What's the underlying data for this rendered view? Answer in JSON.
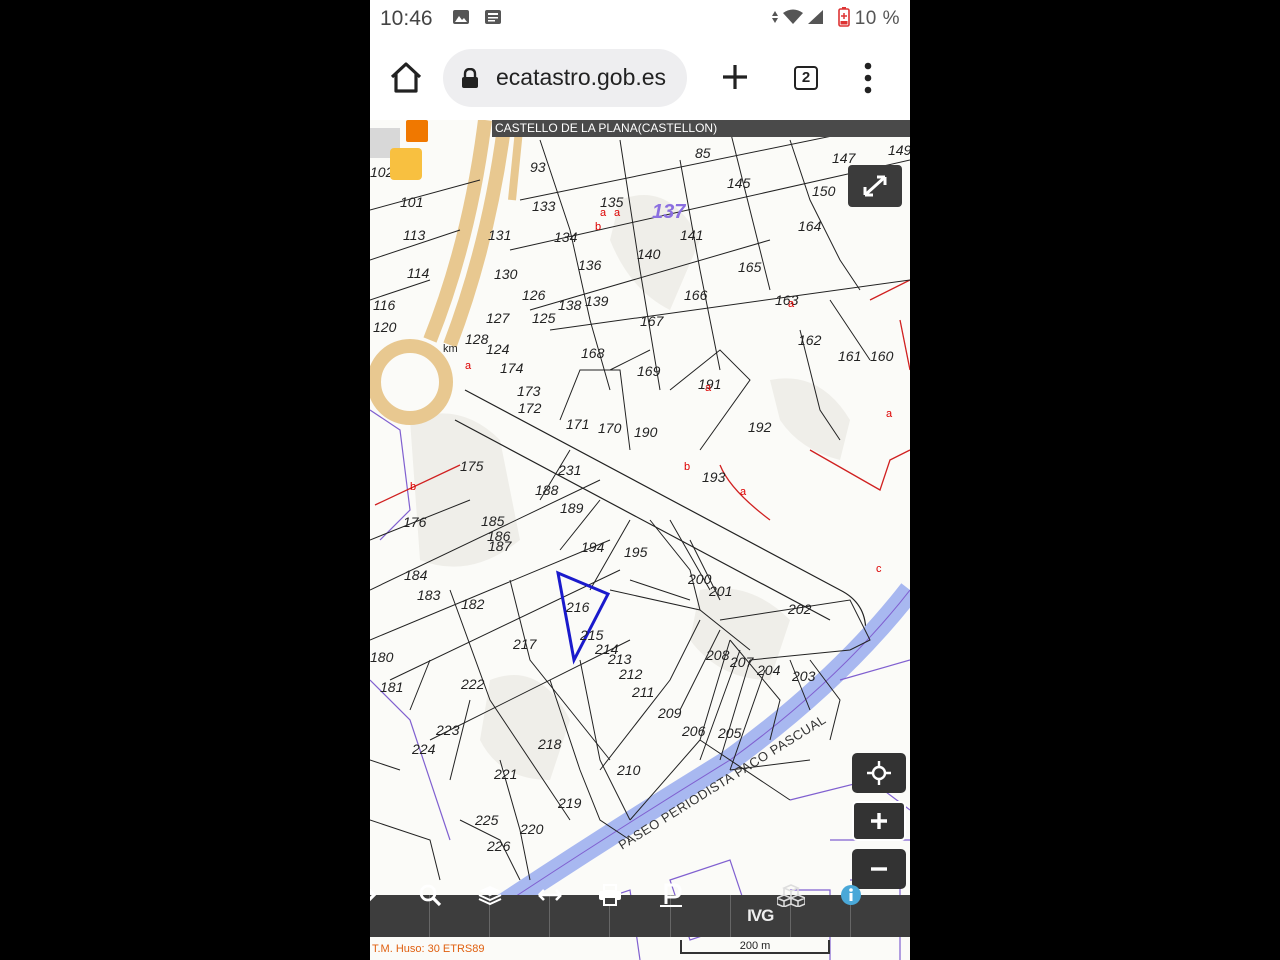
{
  "status_bar": {
    "time": "10:46",
    "battery_pct": "10 %"
  },
  "browser": {
    "url": "ecatastro.gob.es",
    "tab_count": "2"
  },
  "map": {
    "municipality_label": "CASTELLO DE LA PLANA(CASTELLON)",
    "street_label": "PASEO PERIODISTA PACO PASCUAL",
    "parcel_numbers": [
      "85",
      "93",
      "101",
      "102",
      "113",
      "114",
      "116",
      "120",
      "124",
      "125",
      "126",
      "127",
      "128",
      "130",
      "131",
      "133",
      "134",
      "135",
      "136",
      "137",
      "138",
      "139",
      "140",
      "141",
      "145",
      "146",
      "147",
      "149",
      "150",
      "160",
      "161",
      "162",
      "163",
      "164",
      "165",
      "166",
      "167",
      "168",
      "169",
      "170",
      "171",
      "172",
      "173",
      "174",
      "175",
      "176",
      "180",
      "181",
      "182",
      "183",
      "184",
      "185",
      "186",
      "187",
      "188",
      "189",
      "190",
      "191",
      "192",
      "193",
      "194",
      "195",
      "200",
      "201",
      "202",
      "203",
      "204",
      "205",
      "206",
      "207",
      "208",
      "209",
      "210",
      "211",
      "212",
      "213",
      "214",
      "215",
      "216",
      "217",
      "218",
      "219",
      "220",
      "221",
      "222",
      "223",
      "224",
      "225",
      "226",
      "231"
    ],
    "highlighted_parcel": "216",
    "highlighted_block": "137",
    "subparcel_letters": [
      "a",
      "b",
      "c"
    ],
    "km_marker": "km",
    "projection": "T.M. Huso: 30 ETRS89",
    "scale": "200 m"
  },
  "toolbar": {
    "items": [
      "chevron-right-icon",
      "search-icon",
      "layers-icon",
      "measure-icon",
      "print-icon",
      "plot-icon",
      "ivg-button",
      "3d-blocks-icon",
      "info-icon"
    ],
    "ivg_label": "IVG"
  },
  "colors": {
    "toolbar_bg": "#3d3d3d",
    "selection": "#1a1acc",
    "road": "#e8c890",
    "waterway": "#a8b8f0",
    "parcel_lines": "#222222",
    "boundary_purple": "#8060d0",
    "logo_orange": "#f07800",
    "logo_yellow": "#f8c040"
  }
}
